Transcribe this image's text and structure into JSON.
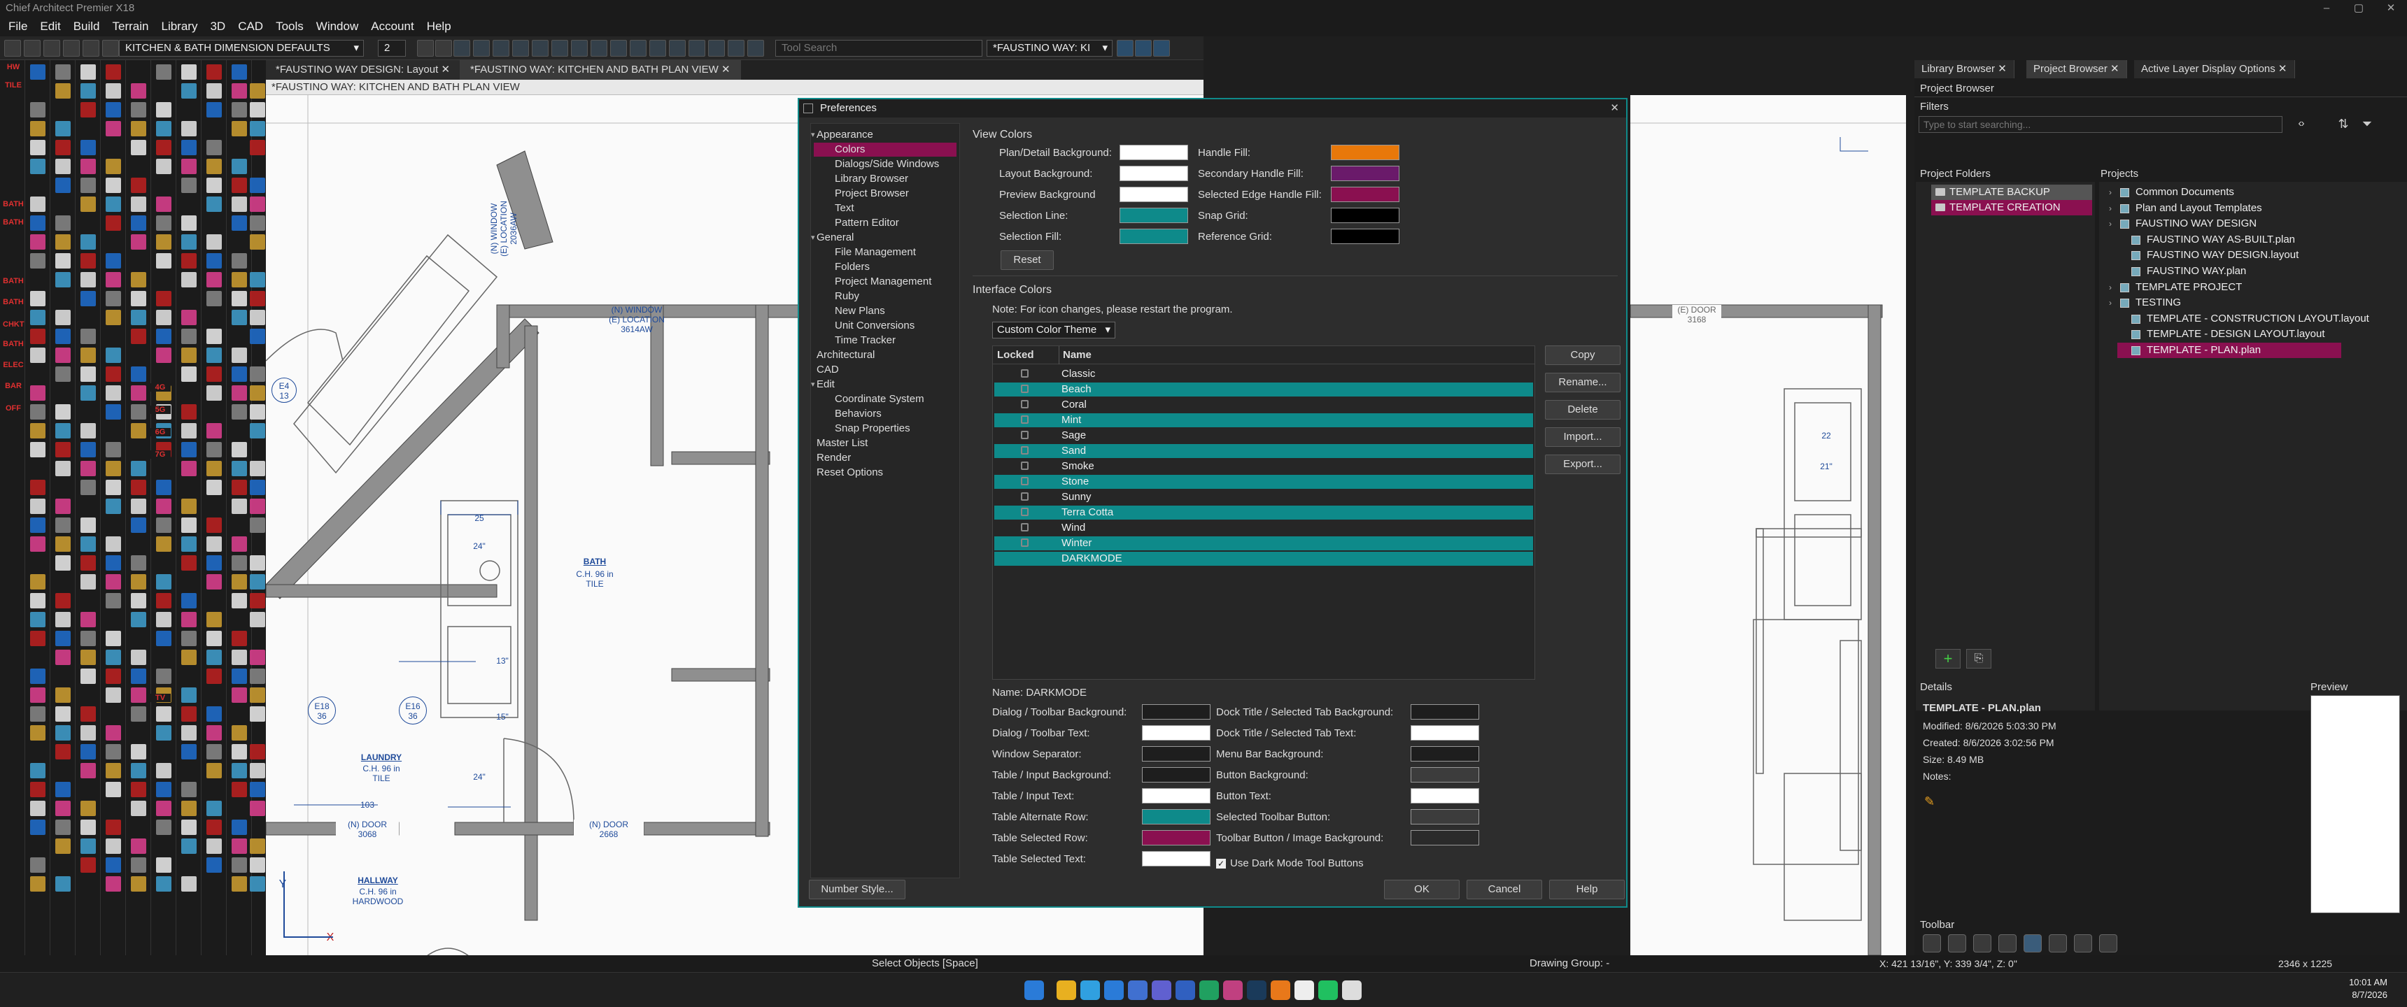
{
  "window_title": "Chief Architect Premier X18",
  "menu": [
    "File",
    "Edit",
    "Build",
    "Terrain",
    "Library",
    "3D",
    "CAD",
    "Tools",
    "Window",
    "Account",
    "Help"
  ],
  "toolbar": {
    "defaults_dropdown": "KITCHEN & BATH DIMENSION DEFAULTS",
    "floor_value": "2",
    "tool_search_placeholder": "Tool Search",
    "view_dropdown": "*FAUSTINO WAY: KI"
  },
  "doc_tabs": [
    "*FAUSTINO WAY DESIGN: Layout",
    "*FAUSTINO WAY: KITCHEN AND BATH PLAN VIEW"
  ],
  "view_title": "*FAUSTINO WAY: KITCHEN AND BATH PLAN VIEW",
  "left_tool_labels": [
    "HW",
    "TILE",
    "BATH",
    "BATH",
    "BATH",
    "BATH",
    "CHKT",
    "BATH",
    "ELEC",
    "BAR",
    "OFF",
    "4G",
    "5G",
    "6G",
    "7G",
    "TV"
  ],
  "plan_labels": {
    "window1": "(N) WINDOW\n(E) LOCATION\n3614AW",
    "window2": "(N) WINDOW\n(E) LOCATION\n2036AW",
    "bath": "BATH",
    "bath_sub": "C.H. 96 in\nTILE",
    "laundry": "LAUNDRY",
    "laundry_sub": "C.H. 96 in\nTILE",
    "hallway": "HALLWAY",
    "hallway_sub": "C.H. 96 in\nHARDWOOD",
    "door1": "(N) DOOR\n3068",
    "door2": "(N) DOOR\n2668",
    "door3": "(E) DOOR\n3168",
    "tag1": "E4\n13",
    "tag2": "E18\n36",
    "tag3": "E16\n36",
    "dim1": "25",
    "dim2": "24\"",
    "dim3": "13\"",
    "dim4": "15\"",
    "dim5": "24\"",
    "dim6": "103",
    "dim7": "22",
    "dim8": "21\"",
    "axis_y": "Y",
    "axis_x": "X"
  },
  "preferences": {
    "title": "Preferences",
    "nav": [
      {
        "label": "Appearance",
        "level": 0,
        "expanded": true
      },
      {
        "label": "Colors",
        "level": 1,
        "selected": true
      },
      {
        "label": "Dialogs/Side Windows",
        "level": 1
      },
      {
        "label": "Library Browser",
        "level": 1
      },
      {
        "label": "Project Browser",
        "level": 1
      },
      {
        "label": "Text",
        "level": 1
      },
      {
        "label": "Pattern Editor",
        "level": 1
      },
      {
        "label": "General",
        "level": 0,
        "expanded": true
      },
      {
        "label": "File Management",
        "level": 1
      },
      {
        "label": "Folders",
        "level": 1
      },
      {
        "label": "Project Management",
        "level": 1
      },
      {
        "label": "Ruby",
        "level": 1
      },
      {
        "label": "New Plans",
        "level": 1
      },
      {
        "label": "Unit Conversions",
        "level": 1
      },
      {
        "label": "Time Tracker",
        "level": 1
      },
      {
        "label": "Architectural",
        "level": 0
      },
      {
        "label": "CAD",
        "level": 0
      },
      {
        "label": "Edit",
        "level": 0,
        "expanded": true
      },
      {
        "label": "Coordinate System",
        "level": 1
      },
      {
        "label": "Behaviors",
        "level": 1
      },
      {
        "label": "Snap Properties",
        "level": 1
      },
      {
        "label": "Master List",
        "level": 0
      },
      {
        "label": "Render",
        "level": 0
      },
      {
        "label": "Reset Options",
        "level": 0
      }
    ],
    "view_colors_heading": "View Colors",
    "view_colors_left": [
      {
        "label": "Plan/Detail Background:",
        "color": "#ffffff"
      },
      {
        "label": "Layout Background:",
        "color": "#ffffff"
      },
      {
        "label": "Preview Background",
        "color": "#ffffff"
      },
      {
        "label": "Selection Line:",
        "color": "#0e8a8a"
      },
      {
        "label": "Selection Fill:",
        "color": "#0e8a8a"
      }
    ],
    "view_colors_right": [
      {
        "label": "Handle Fill:",
        "color": "#e8780a"
      },
      {
        "label": "Secondary Handle Fill:",
        "color": "#6a1a6a"
      },
      {
        "label": "Selected Edge Handle Fill:",
        "color": "#8a1050"
      },
      {
        "label": "Snap Grid:",
        "color": "#000000"
      },
      {
        "label": "Reference Grid:",
        "color": "#000000"
      }
    ],
    "reset_label": "Reset",
    "interface_colors_heading": "Interface Colors",
    "restart_note": "Note: For icon changes, please restart the program.",
    "theme_dropdown": "Custom Color Theme",
    "table_headers": [
      "Locked",
      "Name"
    ],
    "themes": [
      {
        "name": "Classic",
        "locked": true,
        "teal": false
      },
      {
        "name": "Beach",
        "locked": true,
        "teal": true
      },
      {
        "name": "Coral",
        "locked": true,
        "teal": false
      },
      {
        "name": "Mint",
        "locked": true,
        "teal": true
      },
      {
        "name": "Sage",
        "locked": true,
        "teal": false
      },
      {
        "name": "Sand",
        "locked": true,
        "teal": true
      },
      {
        "name": "Smoke",
        "locked": true,
        "teal": false
      },
      {
        "name": "Stone",
        "locked": true,
        "teal": true
      },
      {
        "name": "Sunny",
        "locked": true,
        "teal": false
      },
      {
        "name": "Terra Cotta",
        "locked": true,
        "teal": true
      },
      {
        "name": "Wind",
        "locked": true,
        "teal": false
      },
      {
        "name": "Winter",
        "locked": true,
        "teal": true
      },
      {
        "name": "DARKMODE",
        "locked": false,
        "teal": true
      }
    ],
    "side_buttons": [
      "Copy",
      "Rename...",
      "Delete",
      "Import...",
      "Export..."
    ],
    "name_line": "Name: DARKMODE",
    "interface_left": [
      {
        "label": "Dialog / Toolbar Background:",
        "color": "#1e1e1e"
      },
      {
        "label": "Dialog / Toolbar Text:",
        "color": "#ffffff"
      },
      {
        "label": "Window Separator:",
        "color": "#1e1e1e"
      },
      {
        "label": "Table / Input Background:",
        "color": "#1e1e1e"
      },
      {
        "label": "Table / Input Text:",
        "color": "#ffffff"
      },
      {
        "label": "Table Alternate Row:",
        "color": "#0e8a8a"
      },
      {
        "label": "Table Selected Row:",
        "color": "#8a1050"
      },
      {
        "label": "Table Selected Text:",
        "color": "#ffffff"
      }
    ],
    "interface_right": [
      {
        "label": "Dock Title / Selected Tab Background:",
        "color": "#1e1e1e"
      },
      {
        "label": "Dock Title / Selected Tab Text:",
        "color": "#ffffff"
      },
      {
        "label": "Menu Bar Background:",
        "color": "#1e1e1e"
      },
      {
        "label": "Button Background:",
        "color": "#3c3c3c"
      },
      {
        "label": "Button Text:",
        "color": "#ffffff"
      },
      {
        "label": "Selected Toolbar Button:",
        "color": "#3c3c3c"
      },
      {
        "label": "Toolbar Button / Image Background:",
        "color": "#2a2a2a"
      }
    ],
    "dark_mode_checkbox": "Use Dark Mode Tool Buttons",
    "number_style": "Number Style...",
    "ok": "OK",
    "cancel": "Cancel",
    "help": "Help"
  },
  "right_panel": {
    "tabs": [
      "Library Browser",
      "Project Browser",
      "Active Layer Display Options"
    ],
    "header": "Project Browser",
    "filters_label": "Filters",
    "search_placeholder": "Type to start searching...",
    "project_folders_label": "Project Folders",
    "projects_label": "Projects",
    "folders": [
      {
        "name": "TEMPLATE BACKUP",
        "style": "gray"
      },
      {
        "name": "TEMPLATE CREATION",
        "style": "selected"
      }
    ],
    "projects": [
      {
        "name": "Common Documents",
        "level": 0
      },
      {
        "name": "Plan and Layout Templates",
        "level": 0
      },
      {
        "name": "FAUSTINO WAY DESIGN",
        "level": 0
      },
      {
        "name": "FAUSTINO WAY AS-BUILT.plan",
        "level": 1
      },
      {
        "name": "FAUSTINO WAY DESIGN.layout",
        "level": 1
      },
      {
        "name": "FAUSTINO WAY.plan",
        "level": 1
      },
      {
        "name": "TEMPLATE PROJECT",
        "level": 0
      },
      {
        "name": "TESTING",
        "level": 0
      },
      {
        "name": "TEMPLATE - CONSTRUCTION LAYOUT.layout",
        "level": 1
      },
      {
        "name": "TEMPLATE - DESIGN LAYOUT.layout",
        "level": 1
      },
      {
        "name": "TEMPLATE - PLAN.plan",
        "level": 1,
        "selected": true
      }
    ],
    "details_label": "Details",
    "preview_label": "Preview",
    "detail_name": "TEMPLATE - PLAN.plan",
    "modified": "Modified:  8/6/2026 5:03:30 PM",
    "created": "Created:   8/6/2026 3:02:56 PM",
    "size": "Size:        8.49 MB",
    "notes": "Notes:",
    "toolbar_label": "Toolbar"
  },
  "status": {
    "mode": "Select Objects [Space]",
    "drawing_group": "Drawing Group: -",
    "coords": "X: 421 13/16\", Y: 339 3/4\", Z: 0\"",
    "resolution": "2346 x 1225"
  },
  "clock": {
    "time": "10:01 AM",
    "date": "8/7/2026"
  },
  "colors": {
    "accent_teal": "#0e8a8a",
    "selection_magenta": "#8a1050",
    "ink_blue": "#1473d8"
  }
}
